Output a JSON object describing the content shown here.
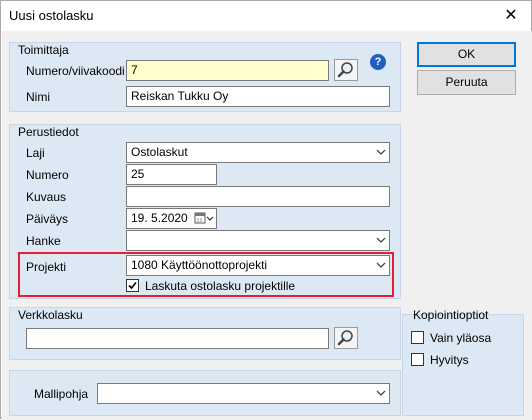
{
  "window": {
    "title": "Uusi ostolasku",
    "close_glyph": "✕"
  },
  "toimittaja": {
    "group_label": "Toimittaja",
    "numero_label": "Numero/viivakoodi",
    "numero_value": "7",
    "nimi_label": "Nimi",
    "nimi_value": "Reiskan Tukku Oy"
  },
  "perustiedot": {
    "group_label": "Perustiedot",
    "laji_label": "Laji",
    "laji_value": "Ostolaskut",
    "numero_label": "Numero",
    "numero_value": "25",
    "kuvaus_label": "Kuvaus",
    "kuvaus_value": "",
    "paivays_label": "Päiväys",
    "paivays_value": "19.  5.2020",
    "hanke_label": "Hanke",
    "hanke_value": "",
    "projekti_label": "Projekti",
    "projekti_value": "1080 Käyttöönottoprojekti",
    "laskuta_label": "Laskuta ostolasku projektille",
    "laskuta_checked": true
  },
  "verkkolasku": {
    "group_label": "Verkkolasku",
    "value": ""
  },
  "mallipohja": {
    "label": "Mallipohja",
    "value": ""
  },
  "kopiointioptiot": {
    "group_label": "Kopiointioptiot",
    "vain_ylaosa_label": "Vain yläosa",
    "vain_ylaosa_checked": false,
    "hyvitys_label": "Hyvitys",
    "hyvitys_checked": false
  },
  "buttons": {
    "ok_label": "OK",
    "peruuta_label": "Peruuta"
  },
  "colors": {
    "group_bg": "#dde8f5",
    "highlight": "#e81e2e",
    "yellow_input": "#ffffcc"
  }
}
